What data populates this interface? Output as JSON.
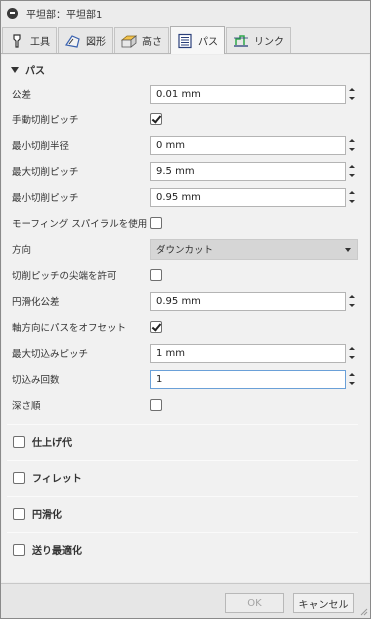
{
  "window": {
    "title": "平坦部：平坦部1"
  },
  "tabs": [
    {
      "label": "工具",
      "icon": "tool-icon"
    },
    {
      "label": "図形",
      "icon": "geometry-icon"
    },
    {
      "label": "高さ",
      "icon": "heights-icon"
    },
    {
      "label": "パス",
      "icon": "passes-icon",
      "active": true
    },
    {
      "label": "リンク",
      "icon": "linking-icon"
    }
  ],
  "passes": {
    "heading": "パス",
    "tolerance": {
      "label": "公差",
      "value": "0.01 mm"
    },
    "manual_stepover": {
      "label": "手動切削ピッチ",
      "checked": true
    },
    "min_cutting_radius": {
      "label": "最小切削半径",
      "value": "0 mm"
    },
    "max_stepover": {
      "label": "最大切削ピッチ",
      "value": "9.5 mm"
    },
    "min_stepover": {
      "label": "最小切削ピッチ",
      "value": "0.95 mm"
    },
    "morphing_spiral": {
      "label": "モーフィング スパイラルを使用",
      "checked": false
    },
    "direction": {
      "label": "方向",
      "value": "ダウンカット"
    },
    "allow_stepover_cusps": {
      "label": "切削ピッチの尖端を許可",
      "checked": false
    },
    "smoothing_tolerance": {
      "label": "円滑化公差",
      "value": "0.95 mm"
    },
    "offset_axial": {
      "label": "軸方向にパスをオフセット",
      "checked": true
    },
    "max_stepdown": {
      "label": "最大切込みピッチ",
      "value": "1 mm"
    },
    "num_stepdowns": {
      "label": "切込み回数",
      "value": "1"
    },
    "depth_first": {
      "label": "深さ順",
      "checked": false
    }
  },
  "groups": {
    "stock_to_leave": {
      "label": "仕上げ代",
      "checked": false
    },
    "fillet": {
      "label": "フィレット",
      "checked": false
    },
    "smoothing": {
      "label": "円滑化",
      "checked": false
    },
    "feed_optimization": {
      "label": "送り最適化",
      "checked": false
    }
  },
  "footer": {
    "ok": "OK",
    "cancel": "キャンセル"
  }
}
